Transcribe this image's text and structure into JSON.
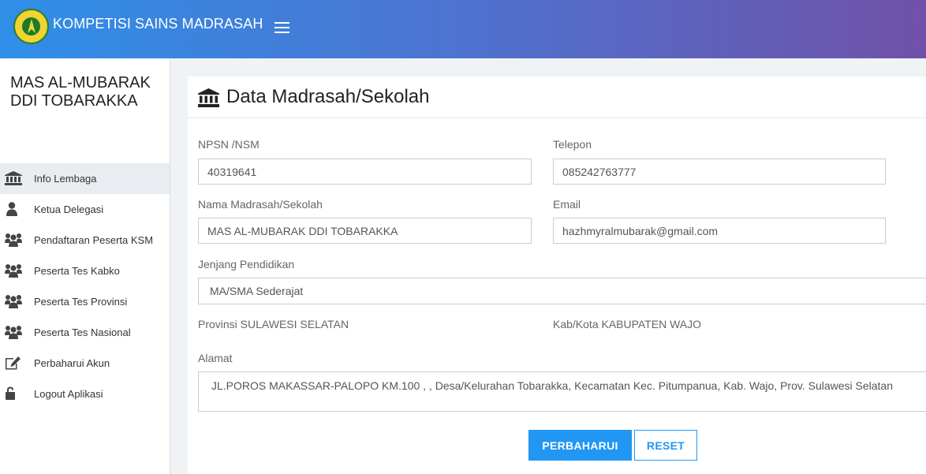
{
  "header": {
    "brand": "KOMPETISI SAINS MADRASAH",
    "logo_icon": "ksm-logo-icon",
    "menu_icon": "hamburger-icon",
    "gradient": [
      "#2f8fe8",
      "#7051a8"
    ]
  },
  "sidebar": {
    "school_name": "MAS AL-MUBARAK DDI TOBARAKKA",
    "items": [
      {
        "label": "Info Lembaga",
        "icon": "institution-icon",
        "active": true
      },
      {
        "label": "Ketua Delegasi",
        "icon": "user-icon",
        "active": false
      },
      {
        "label": "Pendaftaran Peserta KSM",
        "icon": "users-icon",
        "active": false
      },
      {
        "label": "Peserta Tes Kabko",
        "icon": "users-icon",
        "active": false
      },
      {
        "label": "Peserta Tes Provinsi",
        "icon": "users-icon",
        "active": false
      },
      {
        "label": "Peserta Tes Nasional",
        "icon": "users-icon",
        "active": false
      },
      {
        "label": "Perbaharui Akun",
        "icon": "edit-icon",
        "active": false
      },
      {
        "label": "Logout Aplikasi",
        "icon": "unlock-icon",
        "active": false
      }
    ]
  },
  "panel": {
    "title": "Data Madrasah/Sekolah",
    "title_icon": "institution-icon",
    "npsn_label": "NPSN /NSM",
    "npsn_value": "40319641",
    "telepon_label": "Telepon",
    "telepon_value": "085242763777",
    "nama_label": "Nama Madrasah/Sekolah",
    "nama_value": "MAS AL-MUBARAK DDI TOBARAKKA",
    "email_label": "Email",
    "email_value": "hazhmyralmubarak@gmail.com",
    "jenjang_label": "Jenjang Pendidikan",
    "jenjang_value": "MA/SMA Sederajat",
    "provinsi_text": "Provinsi SULAWESI SELATAN",
    "kabkota_text": "Kab/Kota KABUPATEN WAJO",
    "alamat_label": "Alamat",
    "alamat_value": "JL.POROS MAKASSAR-PALOPO KM.100 , , Desa/Kelurahan Tobarakka, Kecamatan Kec. Pitumpanua,  Kab. Wajo, Prov. Sulawesi Selatan",
    "submit_label": "PERBAHARUI",
    "reset_label": "RESET",
    "accent_color": "#2196f3"
  }
}
